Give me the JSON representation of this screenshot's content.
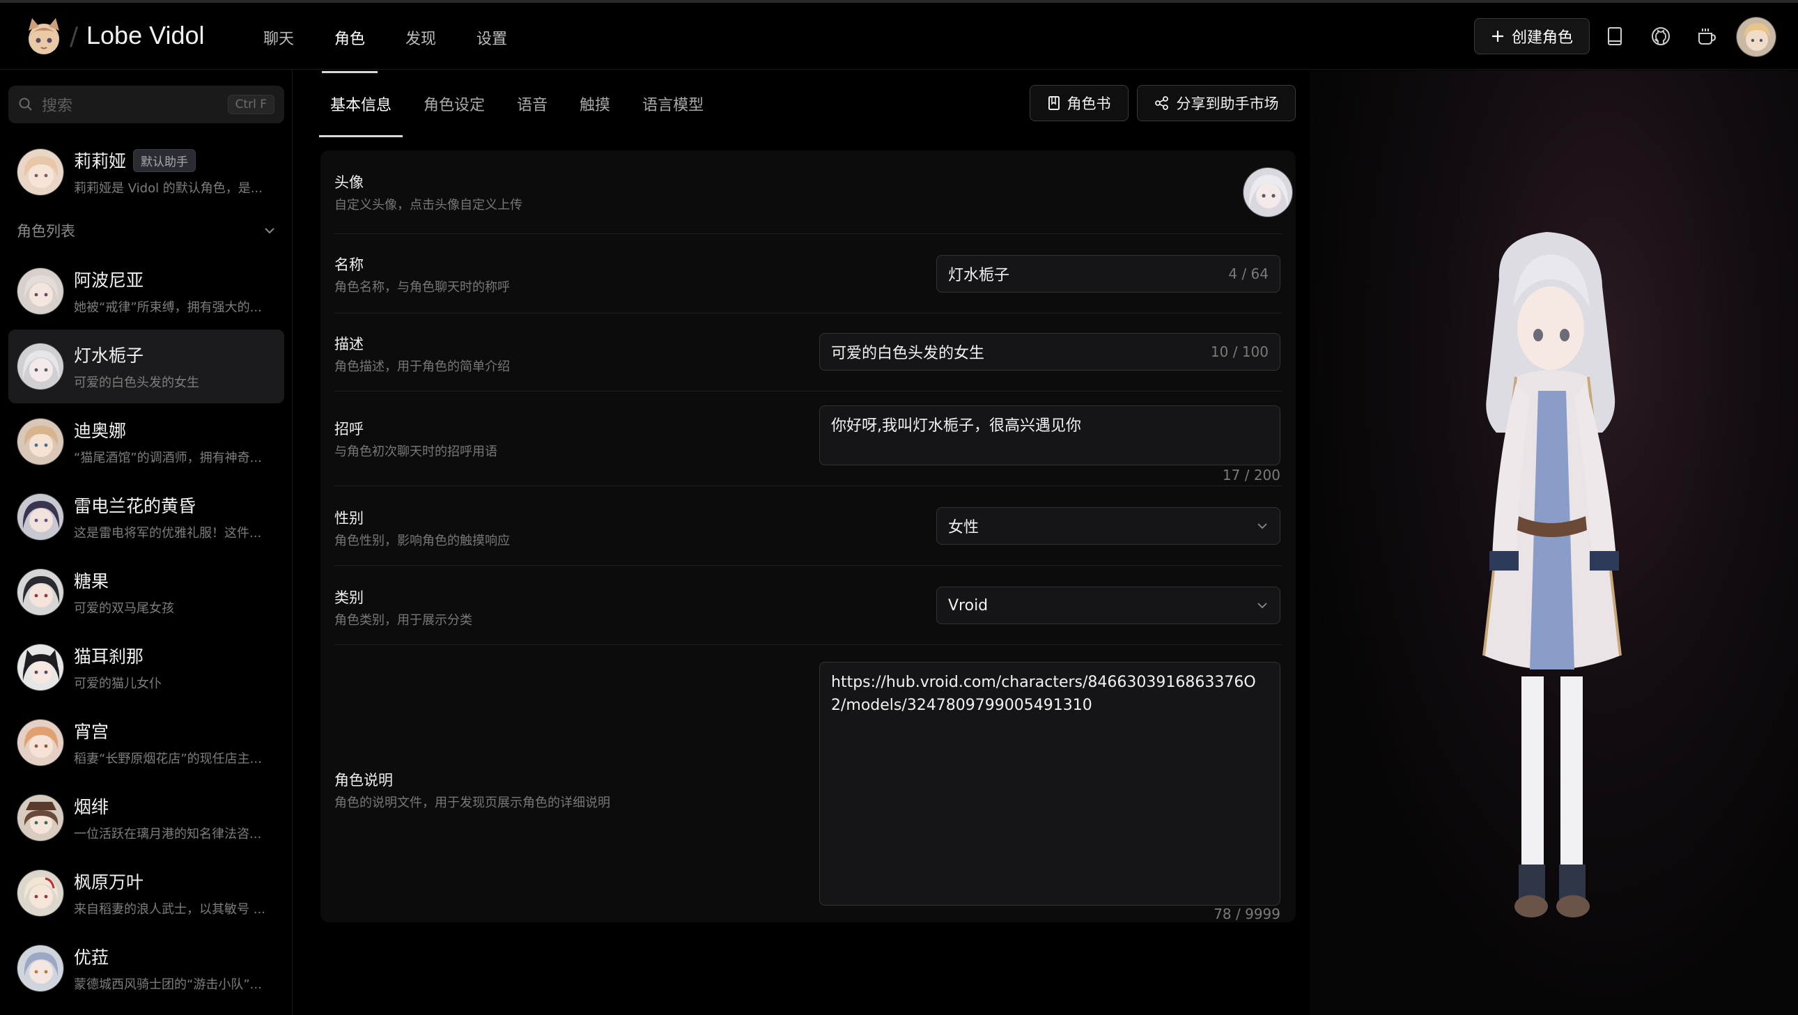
{
  "app": {
    "name": "Lobe Vidol"
  },
  "nav": {
    "items": [
      {
        "label": "聊天",
        "active": false
      },
      {
        "label": "角色",
        "active": true
      },
      {
        "label": "发现",
        "active": false
      },
      {
        "label": "设置",
        "active": false
      }
    ]
  },
  "header": {
    "create_label": "创建角色",
    "icons": [
      "book-icon",
      "github-icon",
      "coffee-icon"
    ]
  },
  "sidebar": {
    "search_placeholder": "搜索",
    "search_shortcut": "Ctrl F",
    "default": {
      "name": "莉莉娅",
      "badge": "默认助手",
      "desc": "莉莉娅是 Vidol 的默认角色，是..."
    },
    "section_title": "角色列表",
    "characters": [
      {
        "name": "阿波尼亚",
        "desc": "她被“戒律”所束缚，拥有强大的..."
      },
      {
        "name": "灯水栀子",
        "desc": "可爱的白色头发的女生"
      },
      {
        "name": "迪奥娜",
        "desc": "“猫尾酒馆”的调酒师，拥有神奇..."
      },
      {
        "name": "雷电兰花的黄昏",
        "desc": "这是雷电将军的优雅礼服！这件..."
      },
      {
        "name": "糖果",
        "desc": "可爱的双马尾女孩"
      },
      {
        "name": "猫耳刹那",
        "desc": "可爱的猫儿女仆"
      },
      {
        "name": "宵宫",
        "desc": "稻妻“长野原烟花店”的现任店主..."
      },
      {
        "name": "烟绯",
        "desc": "一位活跃在璃月港的知名律法咨..."
      },
      {
        "name": "枫原万叶",
        "desc": "来自稻妻的浪人武士，以其敏号 ..."
      },
      {
        "name": "优菈",
        "desc": "蒙德城西风骑士团的“游击小队”..."
      }
    ],
    "selected_index": 1
  },
  "tabs": [
    {
      "label": "基本信息",
      "active": true
    },
    {
      "label": "角色设定",
      "active": false
    },
    {
      "label": "语音",
      "active": false
    },
    {
      "label": "触摸",
      "active": false
    },
    {
      "label": "语言模型",
      "active": false
    }
  ],
  "actions": {
    "role_book": "角色书",
    "share": "分享到助手市场"
  },
  "form": {
    "avatar": {
      "label": "头像",
      "help": "自定义头像，点击头像自定义上传"
    },
    "name": {
      "label": "名称",
      "help": "角色名称，与角色聊天时的称呼",
      "value": "灯水栀子",
      "count": "4 / 64"
    },
    "desc": {
      "label": "描述",
      "help": "角色描述，用于角色的简单介绍",
      "value": "可爱的白色头发的女生",
      "count": "10 / 100"
    },
    "greeting": {
      "label": "招呼",
      "help": "与角色初次聊天时的招呼用语",
      "value": "你好呀,我叫灯水栀子，很高兴遇见你",
      "count": "17 / 200"
    },
    "gender": {
      "label": "性别",
      "help": "角色性别，影响角色的触摸响应",
      "value": "女性"
    },
    "category": {
      "label": "类别",
      "help": "角色类别，用于展示分类",
      "value": "Vroid"
    },
    "readme": {
      "label": "角色说明",
      "help": "角色的说明文件，用于发现页展示角色的详细说明",
      "value": "https://hub.vroid.com/characters/8466303916863376O2/models/3247809799005491310",
      "count": "78 / 9999"
    }
  },
  "colors": {
    "background": "#000000",
    "panel": "#0c0c0d",
    "field": "#151517",
    "border": "#323234",
    "accent_text": "#ffffff"
  }
}
